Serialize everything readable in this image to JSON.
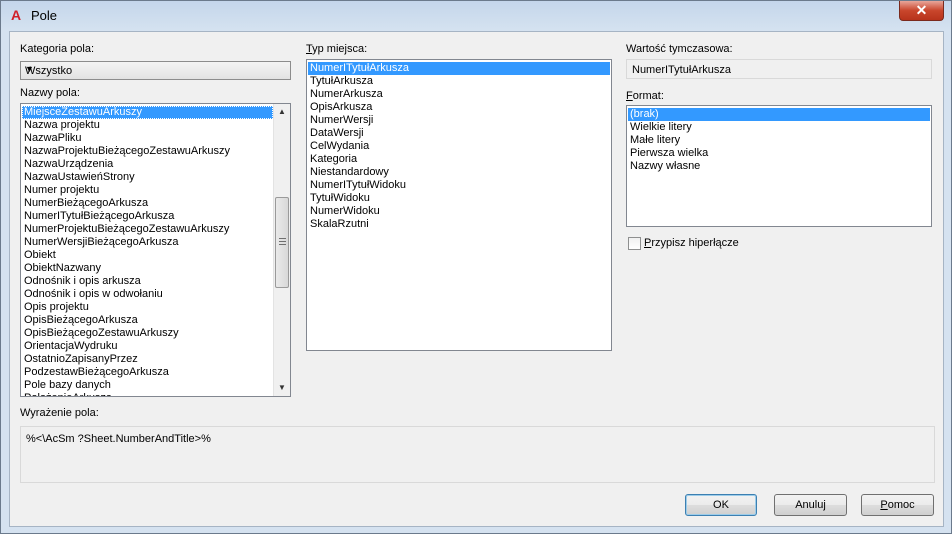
{
  "window": {
    "title": "Pole",
    "app_icon": "autocad-a-icon",
    "close_glyph": "✕"
  },
  "category": {
    "label": "Kategoria pola:",
    "selected": "Wszystko"
  },
  "field_names": {
    "label": "Nazwy pola:",
    "items": [
      "MiejsceZestawuArkuszy",
      "Nazwa projektu",
      "NazwaPliku",
      "NazwaProjektuBieżącegoZestawuArkuszy",
      "NazwaUrządzenia",
      "NazwaUstawieńStrony",
      "Numer projektu",
      "NumerBieżącegoArkusza",
      "NumerITytułBieżącegoArkusza",
      "NumerProjektuBieżącegoZestawuArkuszy",
      "NumerWersjiBieżącegoArkusza",
      "Obiekt",
      "ObiektNazwany",
      "Odnośnik i opis arkusza",
      "Odnośnik i opis w odwołaniu",
      "Opis projektu",
      "OpisBieżącegoArkusza",
      "OpisBieżącegoZestawuArkuszy",
      "OrientacjaWydruku",
      "OstatnioZapisanyPrzez",
      "PodzestawBieżącegoArkusza",
      "Pole bazy danych",
      "PołożenieArkusza"
    ],
    "selected_index": 0
  },
  "place_type": {
    "label": "Typ miejsca:",
    "items": [
      "NumerITytułArkusza",
      "TytułArkusza",
      "NumerArkusza",
      "OpisArkusza",
      "NumerWersji",
      "DataWersji",
      "CelWydania",
      "Kategoria",
      "Niestandardowy",
      "NumerITytułWidoku",
      "TytułWidoku",
      "NumerWidoku",
      "SkalaRzutni"
    ],
    "selected_index": 0
  },
  "temp_value": {
    "label": "Wartość tymczasowa:",
    "value": "NumerITytułArkusza"
  },
  "format": {
    "label": "Format:",
    "items": [
      "(brak)",
      "Wielkie litery",
      "Małe litery",
      "Pierwsza wielka",
      "Nazwy własne"
    ],
    "selected_index": 0
  },
  "hyperlink": {
    "label": "Przypisz hiperłącze",
    "checked": false
  },
  "expression": {
    "label": "Wyrażenie pola:",
    "value": "%<\\AcSm ?Sheet.NumberAndTitle>%"
  },
  "buttons": {
    "ok": "OK",
    "cancel": "Anuluj",
    "help": "Pomoc"
  }
}
